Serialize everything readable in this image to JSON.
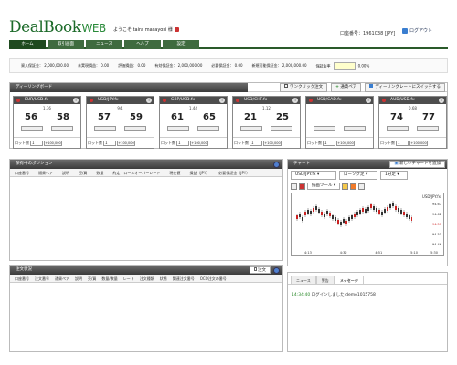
{
  "header": {
    "logo_text": "DealBook",
    "logo_suffix": "WEB",
    "welcome": "ようこそ taira masayosi 様",
    "account": "口座番号：1961038 [JPY]",
    "logout": "ログアウト"
  },
  "nav": {
    "tabs": [
      "ホーム",
      "取引画面",
      "ニュース",
      "ヘルプ",
      "設定"
    ]
  },
  "summary": {
    "cells": [
      "資入保証金： 2,000,000.00",
      "未実現損益： 0.00",
      "評価損益： 0.00",
      "有効保証金： 2,000,000.00",
      "必要保証金： 0.00",
      "新規可能保証金： 2,000,000.00",
      "保証金率",
      "0.00%"
    ]
  },
  "quotes": {
    "title": "ディーリングボード",
    "one_click_label": "ワンクリック注文",
    "add_pair_label": "通貨ペア",
    "switch_label": "ディーリングレートにスイッチする",
    "cards": [
      {
        "pair": "EUR/USD.fx",
        "spread": "1.36",
        "bid": "56",
        "ask": "58",
        "lot_label": "ロット数",
        "lot_value": "1",
        "increment": "+100,000"
      },
      {
        "pair": "USD/JPY.fx",
        "spread": "94.",
        "bid": "57",
        "ask": "59",
        "lot_label": "ロット数",
        "lot_value": "1",
        "increment": "+100,000"
      },
      {
        "pair": "GBP/USD.fx",
        "spread": "1.44",
        "bid": "61",
        "ask": "65",
        "lot_label": "ロット数",
        "lot_value": "1",
        "increment": "+100,000"
      },
      {
        "pair": "USD/CHF.fx",
        "spread": "1.12",
        "bid": "21",
        "ask": "25",
        "lot_label": "ロット数",
        "lot_value": "1",
        "increment": "+100,000"
      },
      {
        "pair": "USD/CAD.fx",
        "spread": "",
        "bid": "",
        "ask": "",
        "lot_label": "ロット数",
        "lot_value": "1",
        "increment": "+100,000"
      },
      {
        "pair": "AUD/USD.fx",
        "spread": "0.68",
        "bid": "74",
        "ask": "77",
        "lot_label": "ロット数",
        "lot_value": "1",
        "increment": "+100,000"
      }
    ]
  },
  "positions": {
    "title": "保有中のポジション",
    "columns": [
      "口座番号",
      "通貨ペア",
      "説明",
      "売/買",
      "数量",
      "約定・ロールオーバーレート",
      "現在値",
      "損益（JPY）",
      "必要保証金（JPY）"
    ]
  },
  "orders": {
    "title": "注文状況",
    "order_button": "注文",
    "columns": [
      "口座番号",
      "注文番号",
      "通貨ペア",
      "説明",
      "売/買",
      "数量/数量",
      "レート",
      "注文種類",
      "状態",
      "関連注文番号",
      "OCO注文の番号"
    ]
  },
  "chart": {
    "title": "チャート",
    "new_chart_button": "新しいチャートを追加",
    "pair_select": "USD/JPY.fx",
    "type_select": "ローソク足",
    "interval_select": "1分足",
    "toolbar_label": "描画ツール",
    "inner_title": "USD/JPY.fx",
    "price_ticks": [
      "94.67",
      "94.62",
      "94.57",
      "94.51",
      "94.46"
    ],
    "current_price": "94.57",
    "time_ticks": [
      "4:13",
      "4:32",
      "4:51",
      "5:10"
    ],
    "time_end": "5:30"
  },
  "messages": {
    "tabs": [
      "ニュース",
      "警告",
      "メッセージ"
    ],
    "active_tab": "メッセージ",
    "time": "14:34:40",
    "text": "ログインしました demo1015758"
  },
  "colors": {
    "brand_green": "#1d6b2a",
    "nav_green": "#3f6b3f",
    "panel_head": "#4a4a4a",
    "link_blue": "#3a7ed0",
    "bull": "#333333",
    "bear": "#cc2222"
  },
  "icons": [
    "lock-icon",
    "info-icon",
    "add-icon",
    "refresh-icon",
    "zoom-icon",
    "chart-icon"
  ]
}
